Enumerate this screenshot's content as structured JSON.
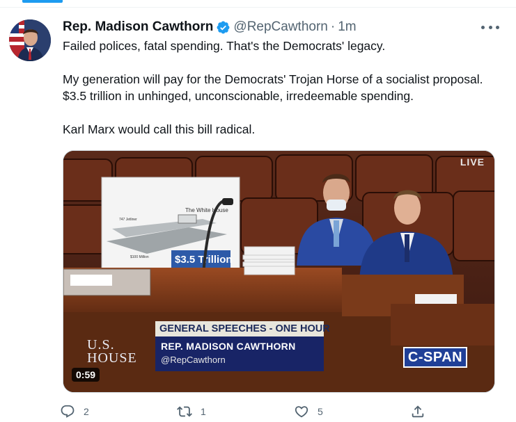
{
  "tweet": {
    "display_name": "Rep. Madison Cawthorn",
    "handle": "@RepCawthorn",
    "separator": "·",
    "time": "1m",
    "paragraphs": [
      "Failed polices, fatal spending. That's the Democrats' legacy.",
      "My generation will pay for the Democrats' Trojan Horse of a socialist proposal. $3.5 trillion in unhinged, unconscionable, irredeemable spending.",
      "Karl Marx would call this bill radical."
    ]
  },
  "video": {
    "live_label": "LIVE",
    "lower_third_title": "GENERAL SPEECHES - ONE HOUR",
    "lower_third_name": "REP. MADISON CAWTHORN",
    "lower_third_handle": "@RepCawthorn",
    "house_logo_line1": "U.S.",
    "house_logo_line2": "HOUSE",
    "network_logo": "C-SPAN",
    "poster_heading": "The White House",
    "poster_caption": "$3.5 Trillion",
    "poster_label_left": "747 Jetliner",
    "poster_label_bottom": "$100 Million",
    "elapsed_time": "0:59"
  },
  "actions": {
    "reply_count": "2",
    "retweet_count": "1",
    "like_count": "5",
    "icons": [
      "reply-icon",
      "retweet-icon",
      "like-icon",
      "share-icon"
    ]
  },
  "colors": {
    "accent": "#1d9bf0",
    "muted_text": "#536471",
    "cspan_blue": "#1f3f97"
  }
}
